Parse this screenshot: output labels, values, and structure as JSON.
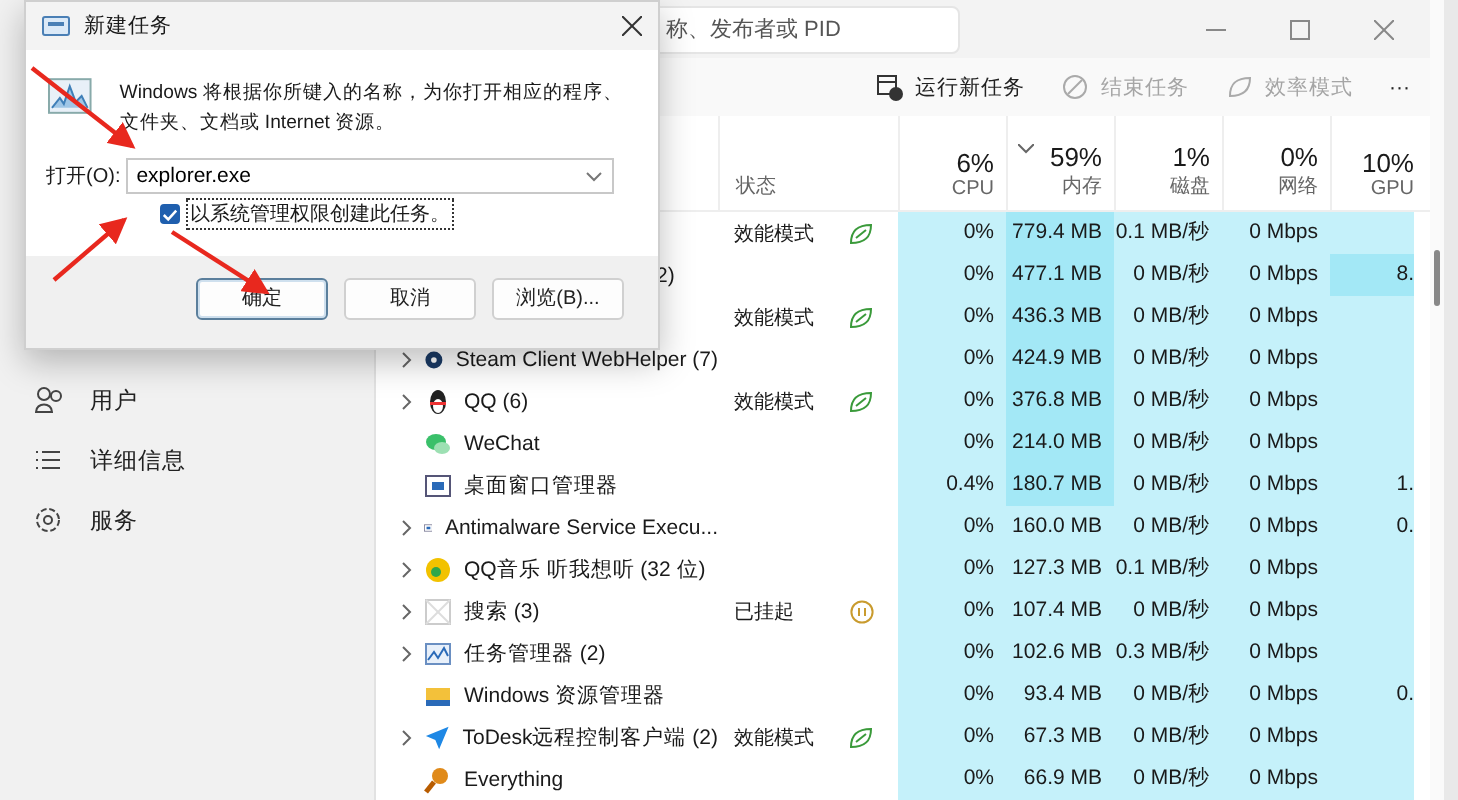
{
  "window": {
    "search": {
      "placeholder": "称、发布者或 PID"
    }
  },
  "toolbar": [
    {
      "label": "运行新任务",
      "disabled": false
    },
    {
      "label": "结束任务",
      "disabled": true
    },
    {
      "label": "效率模式",
      "disabled": true
    },
    {
      "label": "···",
      "disabled": false
    }
  ],
  "sidebar": {
    "items": [
      {
        "label": "用户",
        "selected": false
      },
      {
        "label": "详细信息",
        "selected": false
      },
      {
        "label": "服务",
        "selected": false
      }
    ]
  },
  "columns": [
    {
      "label": "状态"
    },
    {
      "percent": "6%",
      "label": "CPU",
      "sorted": false
    },
    {
      "percent": "59%",
      "label": "内存",
      "sorted": true
    },
    {
      "percent": "1%",
      "label": "磁盘",
      "sorted": false
    },
    {
      "percent": "0%",
      "label": "网络",
      "sorted": false
    },
    {
      "percent": "10%",
      "label": "GPU",
      "sorted": false
    }
  ],
  "rows": [
    {
      "status": {
        "kind": "eco",
        "label": "效能模式"
      },
      "cpu": "0%",
      "memory": "779.4 MB",
      "memory_high": true,
      "disk": "0.1 MB/秒",
      "network": "0 Mbps",
      "gpu_high": false
    },
    {
      "name": "2)",
      "occluded": true,
      "cpu": "0%",
      "memory": "477.1 MB",
      "memory_high": true,
      "disk": "0 MB/秒",
      "network": "0 Mbps",
      "gpu": "8.",
      "gpu_high": true
    },
    {
      "status": {
        "kind": "eco",
        "label": "效能模式"
      },
      "cpu": "0%",
      "memory": "436.3 MB",
      "memory_high": true,
      "disk": "0 MB/秒",
      "network": "0 Mbps",
      "gpu_high": false
    },
    {
      "name": "Steam Client WebHelper (7)",
      "expandable": true,
      "kind": "disc",
      "cpu": "0%",
      "memory": "424.9 MB",
      "memory_high": true,
      "disk": "0 MB/秒",
      "network": "0 Mbps",
      "gpu_high": false
    },
    {
      "name": "QQ (6)",
      "expandable": true,
      "kind": "penguin",
      "status": {
        "kind": "eco",
        "label": "效能模式"
      },
      "cpu": "0%",
      "memory": "376.8 MB",
      "memory_high": true,
      "disk": "0 MB/秒",
      "network": "0 Mbps",
      "gpu_high": false
    },
    {
      "name": "WeChat",
      "expandable": false,
      "kind": "chat",
      "cpu": "0%",
      "memory": "214.0 MB",
      "memory_high": true,
      "disk": "0 MB/秒",
      "network": "0 Mbps",
      "gpu_high": false
    },
    {
      "name": "桌面窗口管理器",
      "expandable": false,
      "kind": "window",
      "cpu": "0.4%",
      "memory": "180.7 MB",
      "memory_high": true,
      "disk": "0 MB/秒",
      "network": "0 Mbps",
      "gpu": "1.",
      "gpu_high": false
    },
    {
      "name": "Antimalware Service Execu...",
      "expandable": true,
      "kind": "window",
      "cpu": "0%",
      "memory": "160.0 MB",
      "memory_high": false,
      "disk": "0 MB/秒",
      "network": "0 Mbps",
      "gpu": "0.",
      "gpu_high": false
    },
    {
      "name": "QQ音乐 听我想听 (32 位)",
      "expandable": true,
      "kind": "note",
      "cpu": "0%",
      "memory": "127.3 MB",
      "memory_high": false,
      "disk": "0.1 MB/秒",
      "network": "0 Mbps",
      "gpu_high": false
    },
    {
      "name": "搜索 (3)",
      "expandable": true,
      "kind": "blank",
      "status": {
        "kind": "suspended",
        "label": "已挂起"
      },
      "cpu": "0%",
      "memory": "107.4 MB",
      "memory_high": false,
      "disk": "0 MB/秒",
      "network": "0 Mbps",
      "gpu_high": false
    },
    {
      "name": "任务管理器 (2)",
      "expandable": true,
      "kind": "chart",
      "cpu": "0%",
      "memory": "102.6 MB",
      "memory_high": false,
      "disk": "0.3 MB/秒",
      "network": "0 Mbps",
      "gpu_high": false
    },
    {
      "name": "Windows 资源管理器",
      "expandable": false,
      "kind": "folder",
      "cpu": "0%",
      "memory": "93.4 MB",
      "memory_high": false,
      "disk": "0 MB/秒",
      "network": "0 Mbps",
      "gpu": "0.",
      "gpu_high": false
    },
    {
      "name": "ToDesk远程控制客户端 (2)",
      "expandable": true,
      "kind": "plane",
      "status": {
        "kind": "eco",
        "label": "效能模式"
      },
      "cpu": "0%",
      "memory": "67.3 MB",
      "memory_high": false,
      "disk": "0 MB/秒",
      "network": "0 Mbps",
      "gpu_high": false
    },
    {
      "name": "Everything",
      "expandable": false,
      "kind": "magnifier",
      "cpu": "0%",
      "memory": "66.9 MB",
      "memory_high": false,
      "disk": "0 MB/秒",
      "network": "0 Mbps",
      "gpu_high": false
    }
  ],
  "dialog": {
    "title": "新建任务",
    "message": "Windows 将根据你所键入的名称，为你打开相应的程序、文件夹、文档或 Internet 资源。",
    "open_label": "打开(O):",
    "value": "explorer.exe",
    "checkbox": {
      "label": "以系统管理权限创建此任务。",
      "checked": true
    },
    "buttons": [
      {
        "label": "确定",
        "selected": true
      },
      {
        "label": "取消",
        "selected": false
      },
      {
        "label": "浏览(B)...",
        "selected": false
      }
    ]
  }
}
